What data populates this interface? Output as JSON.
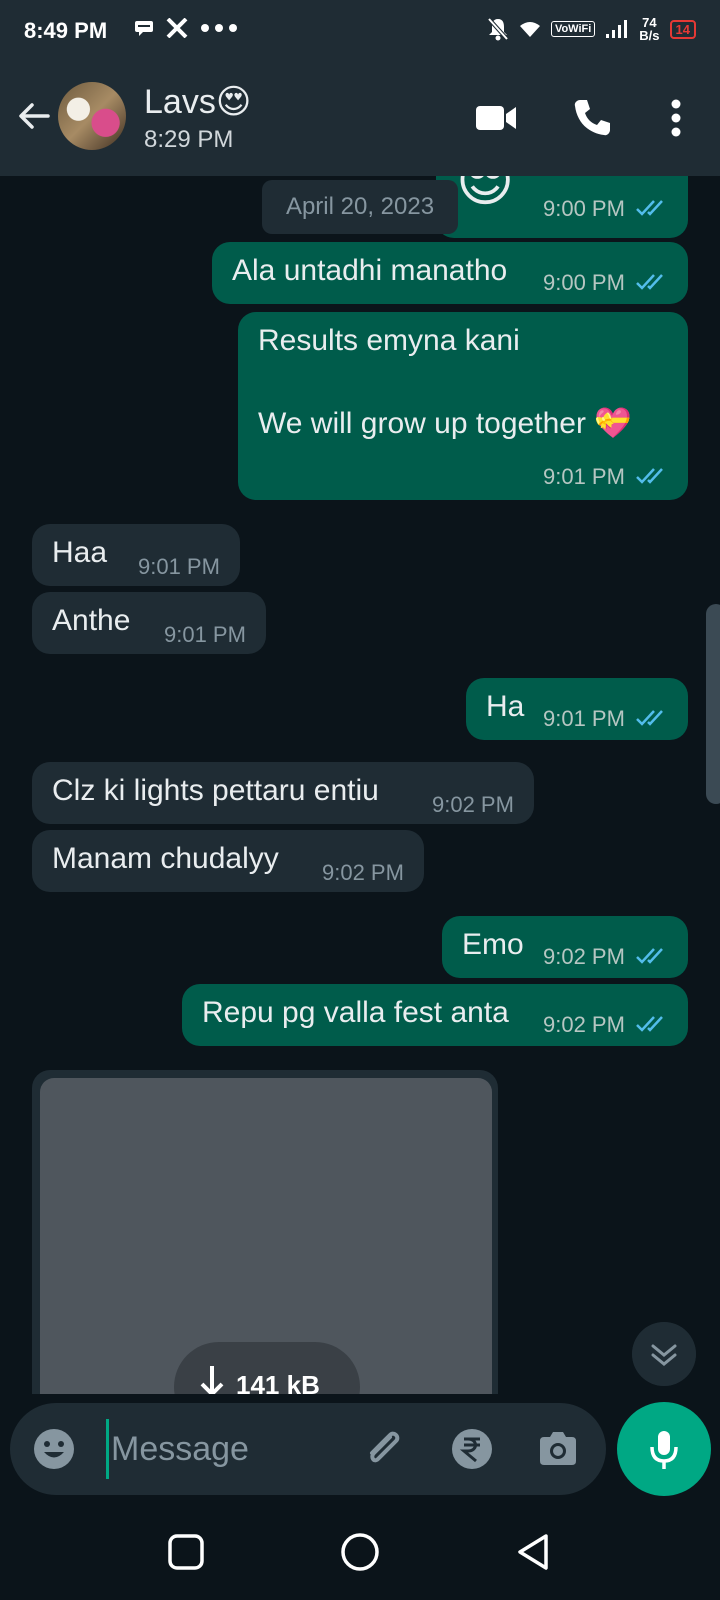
{
  "status_bar": {
    "time": "8:49 PM",
    "left_icons": [
      "message-icon",
      "x-icon",
      "more-dots-icon"
    ],
    "vowifi": "VoWiFi",
    "speed_value": "74",
    "speed_unit": "B/s",
    "battery": "14"
  },
  "header": {
    "contact_name": "Lavs😍",
    "contact_status": "8:29 PM",
    "icons": [
      "back-arrow-icon",
      "video-call-icon",
      "voice-call-icon",
      "more-vert-icon"
    ]
  },
  "chat": {
    "date_separator": "April 20, 2023",
    "messages": [
      {
        "direction": "out",
        "text": "😎",
        "time": "9:00 PM",
        "read": true
      },
      {
        "direction": "out",
        "text": "Ala untadhi manatho",
        "time": "9:00 PM",
        "read": true
      },
      {
        "direction": "out",
        "text_line1": "Results emyna kani",
        "text_line2": "We will grow up together 💝",
        "time": "9:01 PM",
        "read": true
      },
      {
        "direction": "in",
        "text": "Haa",
        "time": "9:01 PM"
      },
      {
        "direction": "in",
        "text": "Anthe",
        "time": "9:01 PM"
      },
      {
        "direction": "out",
        "text": "Ha",
        "time": "9:01 PM",
        "read": true
      },
      {
        "direction": "in",
        "text": "Clz ki lights pettaru entiu",
        "time": "9:02 PM"
      },
      {
        "direction": "in",
        "text": "Manam chudalyy",
        "time": "9:02 PM"
      },
      {
        "direction": "out",
        "text": "Emo",
        "time": "9:02 PM",
        "read": true
      },
      {
        "direction": "out",
        "text": "Repu pg valla fest anta",
        "time": "9:02 PM",
        "read": true
      }
    ],
    "media": {
      "size": "141 kB"
    },
    "colors": {
      "outgoing": "#005c4b",
      "incoming": "#1f2c34",
      "read_ticks": "#53bdeb"
    }
  },
  "composer": {
    "placeholder": "Message",
    "icons": [
      "emoji-icon",
      "attach-icon",
      "rupee-payment-icon",
      "camera-icon",
      "mic-icon"
    ],
    "accent": "#00a884"
  },
  "nav_bar": {
    "icons": [
      "recents-square-icon",
      "home-circle-icon",
      "back-triangle-icon"
    ]
  }
}
